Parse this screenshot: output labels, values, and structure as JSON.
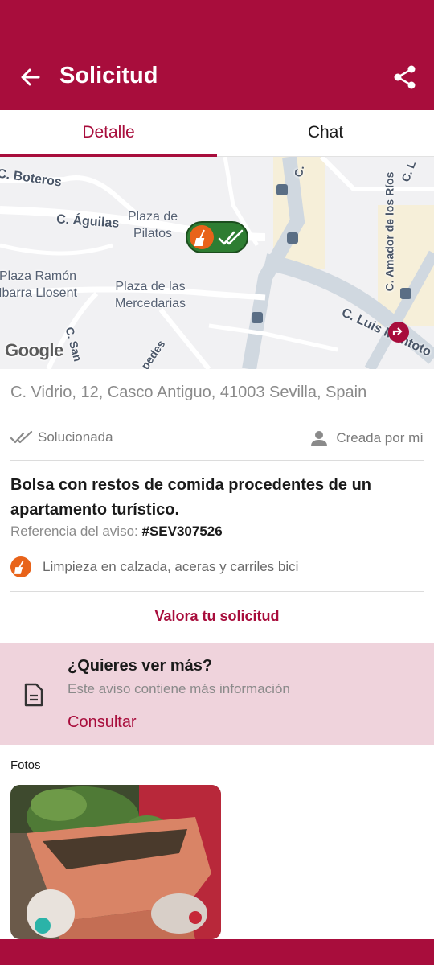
{
  "header": {
    "title": "Solicitud"
  },
  "tabs": [
    {
      "label": "Detalle",
      "active": true
    },
    {
      "label": "Chat",
      "active": false
    }
  ],
  "map": {
    "streets": [
      "C. Boteros",
      "C. Águilas",
      "C. Amador de los Ríos",
      "C. Luis Montoto",
      "C. L",
      "C.",
      "C. San",
      "pedes"
    ],
    "places": [
      "Plaza de Pilatos",
      "Plaza Ramón Ibarra Llosent",
      "Plaza de las Mercedarias"
    ],
    "provider": "Google"
  },
  "request": {
    "address": "C. Vidrio, 12, Casco Antiguo, 41003 Sevilla, Spain",
    "status": "Solucionada",
    "creator": "Creada por mí",
    "description": "Bolsa con restos de comida procedentes de un apartamento turístico.",
    "reference_label": "Referencia del aviso:",
    "reference": "#SEV307526",
    "category": "Limpieza en calzada, aceras y carriles bici"
  },
  "actions": {
    "rate_label": "Valora tu solicitud"
  },
  "more_info": {
    "title": "¿Quieres ver más?",
    "subtitle": "Este aviso contiene más información",
    "link": "Consultar"
  },
  "photos": {
    "label": "Fotos"
  },
  "colors": {
    "primary": "#a80d3c",
    "resolved": "#2e7d32",
    "category": "#e8631a",
    "panel": "#efd3dc"
  }
}
